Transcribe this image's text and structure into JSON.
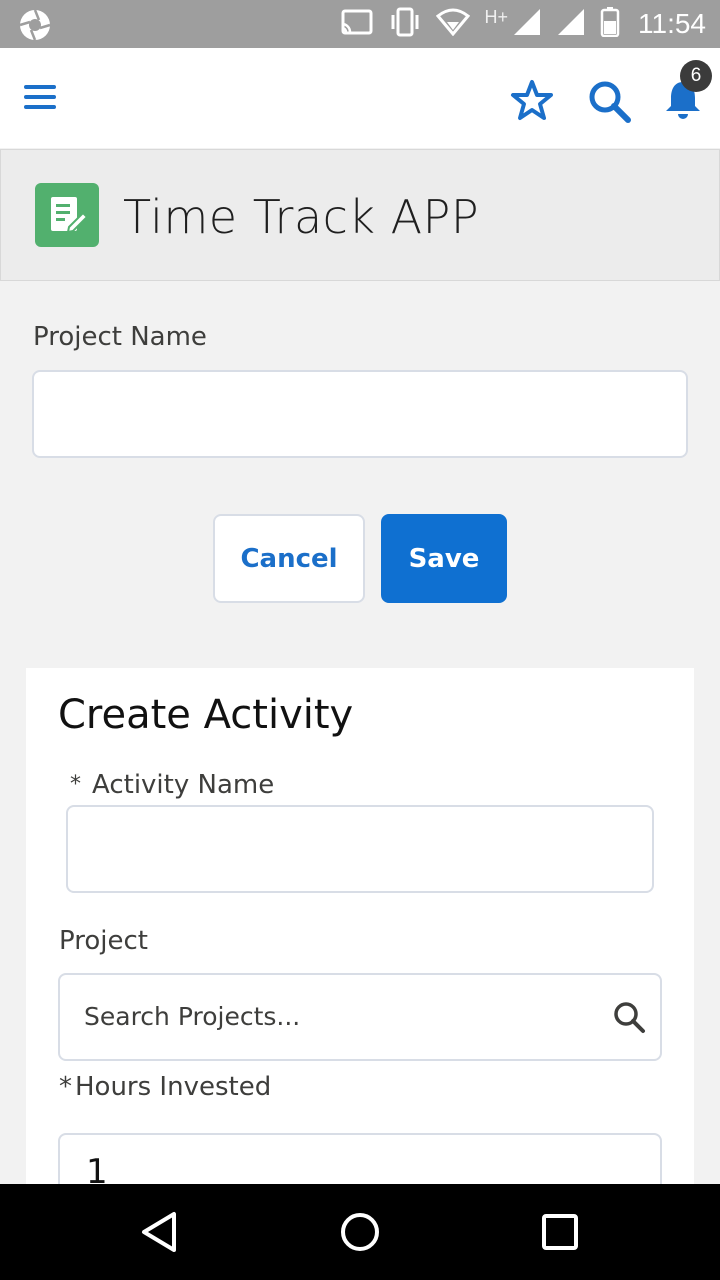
{
  "status_bar": {
    "time": "11:54",
    "network_label": "H+",
    "icons": [
      "aperture-icon",
      "cast-icon",
      "vibrate-icon",
      "wifi-icon",
      "signal-icon",
      "signal-icon",
      "battery-icon"
    ]
  },
  "app_bar": {
    "notification_count": "6",
    "icons": [
      "menu-icon",
      "star-icon",
      "search-icon",
      "bell-icon"
    ]
  },
  "page_header": {
    "title": "Time Track APP",
    "icon": "document-edit-icon"
  },
  "project_form": {
    "project_name_label": "Project Name",
    "project_name_value": "",
    "cancel_label": "Cancel",
    "save_label": "Save"
  },
  "create_activity": {
    "title": "Create Activity",
    "activity_name_required": "*",
    "activity_name_label": "Activity Name",
    "activity_name_value": "",
    "project_label": "Project",
    "project_placeholder": "Search Projects...",
    "hours_required": "*",
    "hours_label": "Hours Invested",
    "hours_value": "1"
  },
  "nav_bar": {
    "icons": [
      "back-icon",
      "home-icon",
      "recents-icon"
    ]
  },
  "colors": {
    "brand_blue": "#0f70d1",
    "app_icon_green": "#52b06e",
    "status_bar": "#9e9e9e"
  }
}
